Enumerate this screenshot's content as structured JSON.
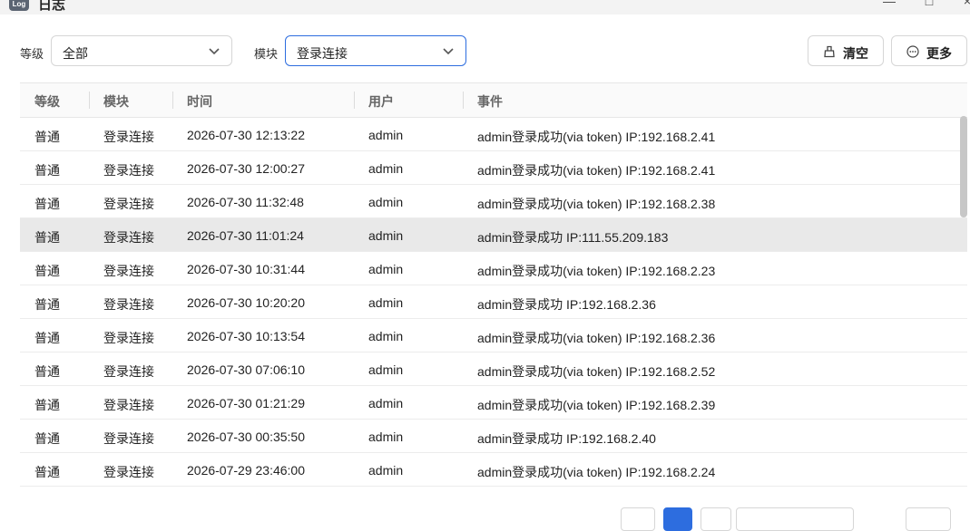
{
  "window": {
    "title": "日志",
    "icon_label": "Log",
    "controls": {
      "minimize": "—",
      "maximize": "□",
      "close": "×"
    }
  },
  "toolbar": {
    "level_label": "等级",
    "level_value": "全部",
    "module_label": "模块",
    "module_value": "登录连接",
    "clear_label": "清空",
    "more_label": "更多"
  },
  "table": {
    "headers": [
      "等级",
      "模块",
      "时间",
      "用户",
      "事件"
    ],
    "rows": [
      {
        "level": "普通",
        "module": "登录连接",
        "time": "2026-07-30 12:13:22",
        "user": "admin",
        "event": "admin登录成功(via token) IP:192.168.2.41"
      },
      {
        "level": "普通",
        "module": "登录连接",
        "time": "2026-07-30 12:00:27",
        "user": "admin",
        "event": "admin登录成功(via token) IP:192.168.2.41"
      },
      {
        "level": "普通",
        "module": "登录连接",
        "time": "2026-07-30 11:32:48",
        "user": "admin",
        "event": "admin登录成功(via token) IP:192.168.2.38"
      },
      {
        "level": "普通",
        "module": "登录连接",
        "time": "2026-07-30 11:01:24",
        "user": "admin",
        "event": "admin登录成功 IP:111.55.209.183"
      },
      {
        "level": "普通",
        "module": "登录连接",
        "time": "2026-07-30 10:31:44",
        "user": "admin",
        "event": "admin登录成功(via token) IP:192.168.2.23"
      },
      {
        "level": "普通",
        "module": "登录连接",
        "time": "2026-07-30 10:20:20",
        "user": "admin",
        "event": "admin登录成功 IP:192.168.2.36"
      },
      {
        "level": "普通",
        "module": "登录连接",
        "time": "2026-07-30 10:13:54",
        "user": "admin",
        "event": "admin登录成功(via token) IP:192.168.2.36"
      },
      {
        "level": "普通",
        "module": "登录连接",
        "time": "2026-07-30 07:06:10",
        "user": "admin",
        "event": "admin登录成功(via token) IP:192.168.2.52"
      },
      {
        "level": "普通",
        "module": "登录连接",
        "time": "2026-07-30 01:21:29",
        "user": "admin",
        "event": "admin登录成功(via token) IP:192.168.2.39"
      },
      {
        "level": "普通",
        "module": "登录连接",
        "time": "2026-07-30 00:35:50",
        "user": "admin",
        "event": "admin登录成功 IP:192.168.2.40"
      },
      {
        "level": "普通",
        "module": "登录连接",
        "time": "2026-07-29 23:46:00",
        "user": "admin",
        "event": "admin登录成功(via token) IP:192.168.2.24"
      }
    ],
    "highlighted_row": 3
  },
  "colors": {
    "accent": "#2d6ddf",
    "row_highlight": "#e9e9e9"
  }
}
